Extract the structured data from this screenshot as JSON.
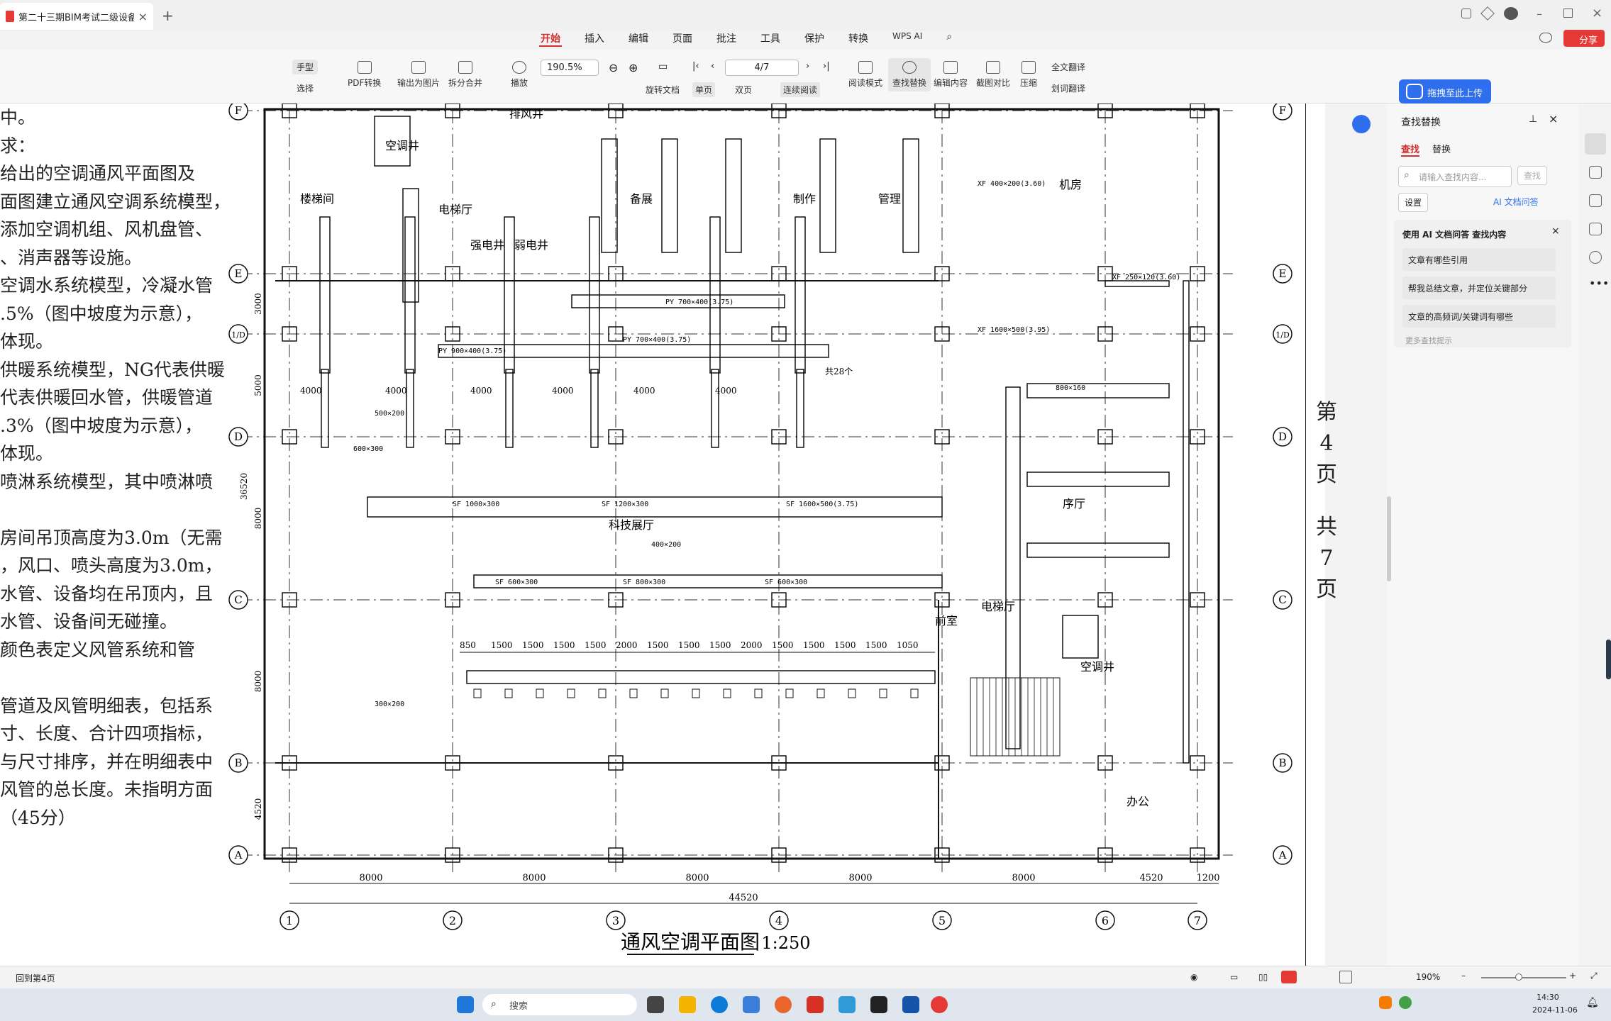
{
  "titlebar": {
    "doc_tab_title": "第二十三期BIM考试二级设备",
    "add_tab": "+",
    "close": "×"
  },
  "menu": {
    "tabs": [
      "开始",
      "插入",
      "编辑",
      "页面",
      "批注",
      "工具",
      "保护",
      "转换"
    ],
    "active": "开始",
    "wps_ai": "WPS AI",
    "share": "分享"
  },
  "toolbar": {
    "hand": "手型",
    "select": "选择",
    "pdf_convert": "PDF转换",
    "export_image": "输出为图片",
    "split_merge": "拆分合并",
    "play": "播放",
    "zoom_value": "190.5%",
    "page_value": "4/7",
    "rotate": "旋转文档",
    "single": "单页",
    "double": "双页",
    "continuous": "连续阅读",
    "read_mode": "阅读模式",
    "find_replace": "查找替换",
    "edit_content": "编辑内容",
    "screenshot_compare": "截图对比",
    "compress": "压缩",
    "full_translate": "全文翻译",
    "word_translate": "划词翻译"
  },
  "upload_button": "拖拽至此上传",
  "document": {
    "left_text": [
      "中。",
      "求：",
      "给出的空调通风平面图及",
      "面图建立通风空调系统模型，",
      "添加空调机组、风机盘管、",
      "、消声器等设施。",
      "空调水系统模型，冷凝水管",
      ".5%（图中坡度为示意），",
      "体现。",
      "供暖系统模型，NG代表供暖",
      "代表供暖回水管，供暖管道",
      ".3%（图中坡度为示意），",
      "体现。",
      "喷淋系统模型，其中喷淋喷",
      "",
      "房间吊顶高度为3.0m（无需",
      "，风口、喷头高度为3.0m，",
      "水管、设备均在吊顶内，且",
      "水管、设备间无碰撞。",
      "颜色表定义风管系统和管",
      "",
      "管道及风管明细表，包括系",
      "寸、长度、合计四项指标，",
      "与尺寸排序，并在明细表中",
      "风管的总长度。未指明方面",
      "（45分）"
    ],
    "page_note": [
      "第",
      "4",
      "页",
      "共",
      "7",
      "页"
    ],
    "drawing": {
      "title": "通风空调平面图",
      "scale": "1:250",
      "axes_x": [
        "1",
        "2",
        "3",
        "4",
        "5",
        "6",
        "7"
      ],
      "axes_y": [
        "F",
        "E",
        "1/D",
        "D",
        "C",
        "B",
        "A"
      ],
      "bottom_dims": [
        "8000",
        "8000",
        "8000",
        "8000",
        "8000",
        "4520",
        "1200"
      ],
      "total_dim": "44520",
      "left_dims": [
        "3000",
        "5000",
        "8000",
        "8000",
        "4520"
      ],
      "total_left": "36520",
      "rooms": [
        "楼梯间",
        "空调井",
        "电梯厅",
        "强电井",
        "弱电井",
        "排风井",
        "备展",
        "制作",
        "管理",
        "机房",
        "科技展厅",
        "序厅",
        "电梯厅",
        "空调井",
        "办公",
        "前室"
      ],
      "duct_labels": [
        "PY 700×400(3.75)",
        "PY 900×400(3.75)",
        "PY 700×400(3.75)",
        "SF 1000×300",
        "SF 1200×300",
        "SF 1600×500(3.75)",
        "SF 600×300",
        "SF 800×300",
        "SF 600×300",
        "XF 1600×500(3.95)",
        "XF 250×120(3.60)",
        "XF 400×200(3.60)",
        "800×160",
        "500×200",
        "300×200",
        "600×300",
        "400×200"
      ],
      "air_dims": [
        "850",
        "1500",
        "1500",
        "1500",
        "1500",
        "2000",
        "1500",
        "1500",
        "1500",
        "2000",
        "1500",
        "1500",
        "1500",
        "1500",
        "1050"
      ],
      "spacing": "4000",
      "count_note": "共28个"
    }
  },
  "right_panel": {
    "title": "查找替换",
    "tab_find": "查找",
    "tab_replace": "替换",
    "placeholder": "请输入查找内容...",
    "search_btn": "查找",
    "settings": "设置",
    "ai_qa": "AI 文档问答",
    "ai_hint": "使用 AI 文档问答 查找内容",
    "suggestions": [
      "文章有哪些引用",
      "帮我总结文章，并定位关键部分",
      "文章的高频词/关键词有哪些"
    ],
    "more": "更多查找提示"
  },
  "statusbar": {
    "back": "回到第4页",
    "zoom": "190%"
  },
  "taskbar": {
    "search": "搜索",
    "time": "14:30",
    "date": "2024-11-06"
  }
}
